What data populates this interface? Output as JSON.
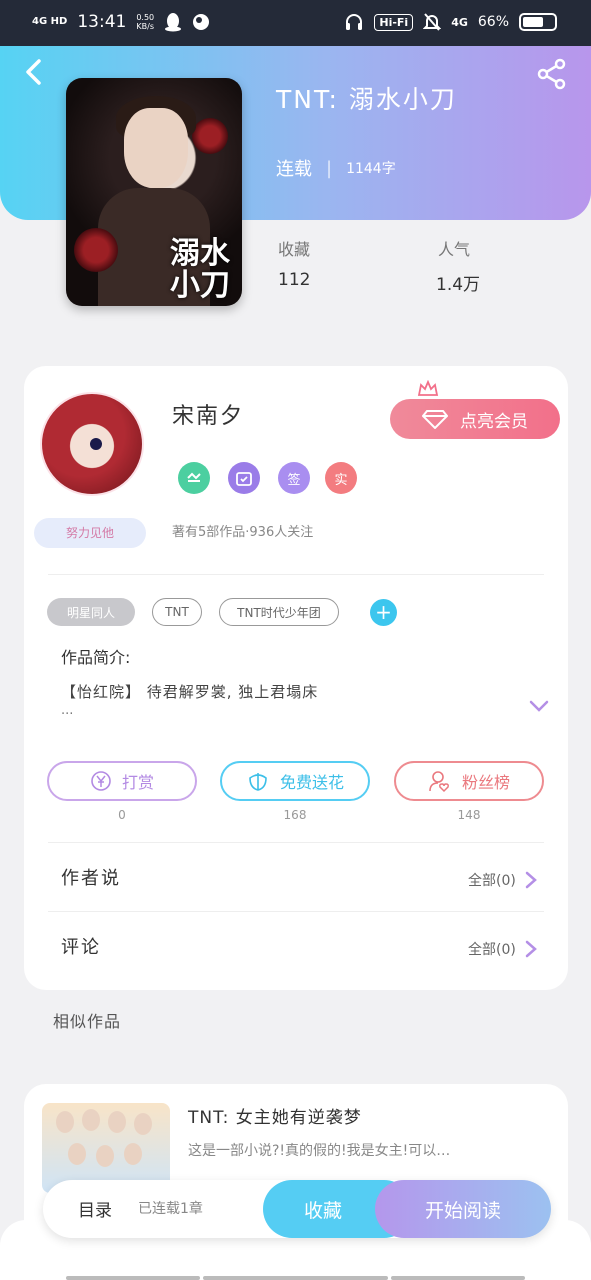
{
  "status_bar": {
    "signal": "4G HD",
    "time": "13:41",
    "net_speed_value": "0.50",
    "net_speed_unit": "KB/s",
    "hifi": "Hi-Fi",
    "network": "4G",
    "battery": "66%",
    "battery_level": 0.66
  },
  "book": {
    "title": "TNT:  溺水小刀",
    "cover_title": "溺水小刀",
    "status": "连载",
    "words": "1144字",
    "stats": [
      {
        "label": "收藏",
        "value": "112"
      },
      {
        "label": "人气",
        "value": "1.4万"
      }
    ]
  },
  "author": {
    "name": "宋南夕",
    "badge": "努力见他",
    "vip_button": "点亮会员",
    "medals": [
      "签",
      "实"
    ],
    "stats": "著有5部作品·936人关注"
  },
  "tags": [
    "明星同人",
    "TNT",
    "TNT时代少年团"
  ],
  "intro": {
    "title": "作品简介:",
    "text": "【怡红院】 待君解罗裳, 独上君塌床",
    "more": "···"
  },
  "actions": [
    {
      "label": "打赏",
      "count": "0"
    },
    {
      "label": "免费送花",
      "count": "168"
    },
    {
      "label": "粉丝榜",
      "count": "148"
    }
  ],
  "rows": [
    {
      "title": "作者说",
      "right": "全部(0)"
    },
    {
      "title": "评论",
      "right": "全部(0)"
    }
  ],
  "similar": {
    "heading": "相似作品",
    "items": [
      {
        "title": "TNT:  女主她有逆袭梦",
        "desc": "这是一部小说?!真的假的!我是女主!可以…"
      }
    ]
  },
  "bottom_bar": {
    "toc": "目录",
    "toc_status": "已连载1章",
    "favorite": "收藏",
    "read": "开始阅读"
  },
  "colors": {
    "header_start": "#56d3f3",
    "header_end": "#b896ec",
    "vip": "#f2708a",
    "accent_cyan": "#3cc6ee"
  }
}
